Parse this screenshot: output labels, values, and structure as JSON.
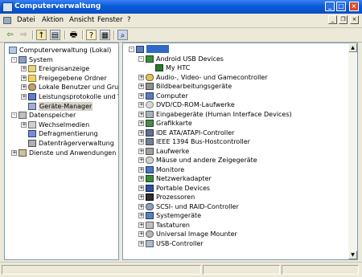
{
  "window": {
    "title": "Computerverwaltung"
  },
  "menu": [
    "Datei",
    "Aktion",
    "Ansicht",
    "Fenster",
    "?"
  ],
  "left_tree": [
    {
      "label": "Computerverwaltung (Lokal)",
      "level": 0,
      "expander": "",
      "icon": "computer-management-icon"
    },
    {
      "label": "System",
      "level": 1,
      "expander": "-",
      "icon": "system-tools-icon"
    },
    {
      "label": "Ereignisanzeige",
      "level": 2,
      "expander": "+",
      "icon": "event-viewer-icon"
    },
    {
      "label": "Freigegebene Ordner",
      "level": 2,
      "expander": "+",
      "icon": "shared-folders-icon"
    },
    {
      "label": "Lokale Benutzer und Gruppe",
      "level": 2,
      "expander": "+",
      "icon": "users-icon"
    },
    {
      "label": "Leistungsprotokolle und War",
      "level": 2,
      "expander": "+",
      "icon": "performance-icon"
    },
    {
      "label": "Geräte-Manager",
      "level": 2,
      "expander": "",
      "icon": "device-manager-icon",
      "selected": true
    },
    {
      "label": "Datenspeicher",
      "level": 1,
      "expander": "-",
      "icon": "storage-icon"
    },
    {
      "label": "Wechselmedien",
      "level": 2,
      "expander": "+",
      "icon": "removable-storage-icon"
    },
    {
      "label": "Defragmentierung",
      "level": 2,
      "expander": "",
      "icon": "defrag-icon"
    },
    {
      "label": "Datenträgerverwaltung",
      "level": 2,
      "expander": "",
      "icon": "disk-management-icon"
    },
    {
      "label": "Dienste und Anwendungen",
      "level": 1,
      "expander": "+",
      "icon": "services-icon"
    }
  ],
  "device_tree": [
    {
      "label": "",
      "level": 0,
      "expander": "-",
      "icon": "computer-icon",
      "root": true
    },
    {
      "label": "Android USB Devices",
      "level": 1,
      "expander": "-",
      "icon": "android-usb-icon"
    },
    {
      "label": "My HTC",
      "level": 2,
      "expander": "",
      "icon": "phone-device-icon"
    },
    {
      "label": "Audio-, Video- und Gamecontroller",
      "level": 1,
      "expander": "+",
      "icon": "audio-icon"
    },
    {
      "label": "Bildbearbeitungsgeräte",
      "level": 1,
      "expander": "+",
      "icon": "imaging-icon"
    },
    {
      "label": "Computer",
      "level": 1,
      "expander": "+",
      "icon": "computer-icon"
    },
    {
      "label": "DVD/CD-ROM-Laufwerke",
      "level": 1,
      "expander": "+",
      "icon": "dvd-icon"
    },
    {
      "label": "Eingabegeräte (Human Interface Devices)",
      "level": 1,
      "expander": "+",
      "icon": "hid-icon"
    },
    {
      "label": "Grafikkarte",
      "level": 1,
      "expander": "+",
      "icon": "display-adapter-icon"
    },
    {
      "label": "IDE ATA/ATAPI-Controller",
      "level": 1,
      "expander": "+",
      "icon": "ide-icon"
    },
    {
      "label": "IEEE 1394 Bus-Hostcontroller",
      "level": 1,
      "expander": "+",
      "icon": "firewire-icon"
    },
    {
      "label": "Laufwerke",
      "level": 1,
      "expander": "+",
      "icon": "disk-drive-icon"
    },
    {
      "label": "Mäuse und andere Zeigegeräte",
      "level": 1,
      "expander": "+",
      "icon": "mouse-icon"
    },
    {
      "label": "Monitore",
      "level": 1,
      "expander": "+",
      "icon": "monitor-icon"
    },
    {
      "label": "Netzwerkadapter",
      "level": 1,
      "expander": "+",
      "icon": "network-adapter-icon"
    },
    {
      "label": "Portable Devices",
      "level": 1,
      "expander": "+",
      "icon": "portable-device-icon"
    },
    {
      "label": "Prozessoren",
      "level": 1,
      "expander": "+",
      "icon": "processor-icon"
    },
    {
      "label": "SCSI- und RAID-Controller",
      "level": 1,
      "expander": "+",
      "icon": "scsi-icon"
    },
    {
      "label": "Systemgeräte",
      "level": 1,
      "expander": "+",
      "icon": "system-device-icon"
    },
    {
      "label": "Tastaturen",
      "level": 1,
      "expander": "+",
      "icon": "keyboard-icon"
    },
    {
      "label": "Universal Image Mounter",
      "level": 1,
      "expander": "+",
      "icon": "image-mounter-icon"
    },
    {
      "label": "USB-Controller",
      "level": 1,
      "expander": "+",
      "icon": "usb-icon"
    }
  ],
  "colors": {
    "titlebar": "#0a5ad8",
    "selection": "#316ac5",
    "window_bg": "#ece9d8"
  }
}
